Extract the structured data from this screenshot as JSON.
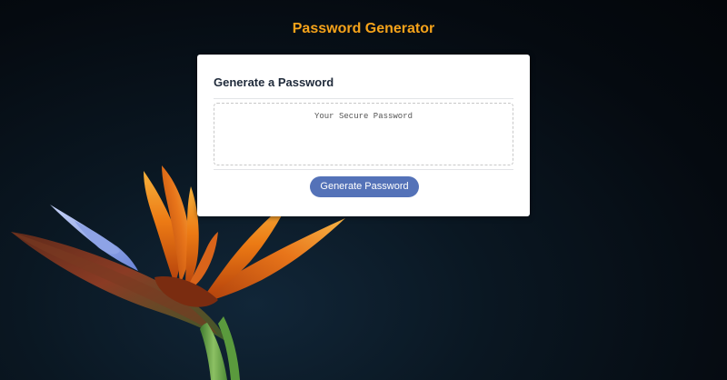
{
  "header": {
    "title": "Password Generator"
  },
  "card": {
    "title": "Generate a Password",
    "password_field": {
      "value": "",
      "placeholder": "Your Secure Password"
    },
    "generate_button_label": "Generate Password"
  },
  "theme": {
    "title_color": "#f5a31a",
    "button_color": "#5472b8",
    "background_color": "#050a10"
  },
  "background": {
    "image": "bird-of-paradise-flower"
  }
}
